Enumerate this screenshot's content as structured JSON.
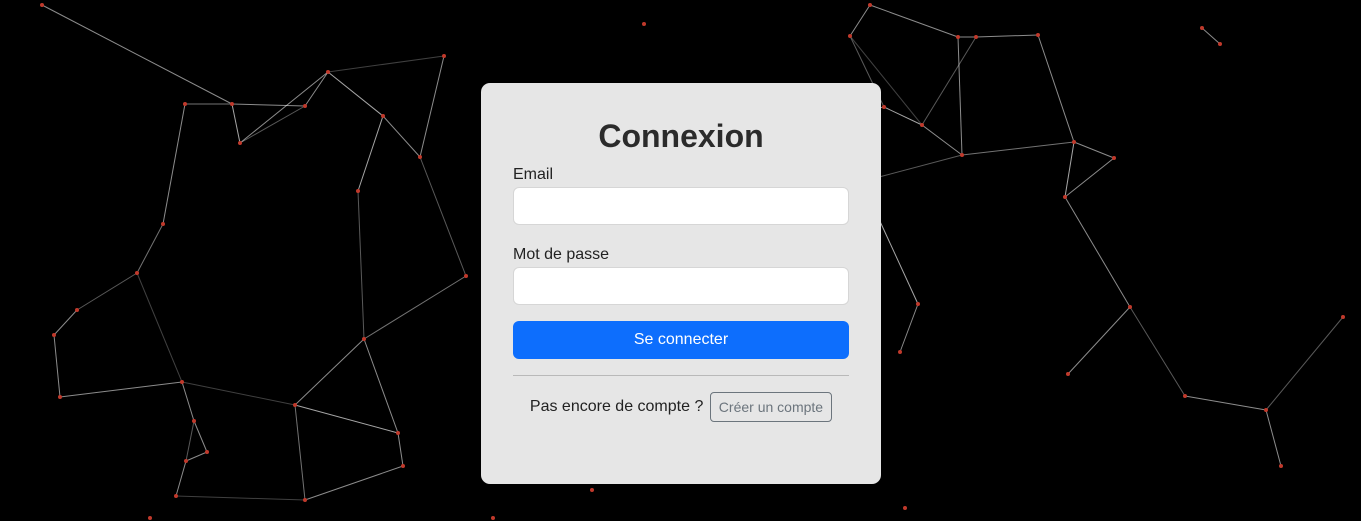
{
  "login": {
    "title": "Connexion",
    "email_label": "Email",
    "email_value": "",
    "password_label": "Mot de passe",
    "password_value": "",
    "submit_label": "Se connecter",
    "no_account_text": "Pas encore de compte ?",
    "register_label": "Créer un compte"
  },
  "colors": {
    "background": "#000000",
    "card": "#e6e6e6",
    "primary": "#0d6efd",
    "secondary": "#6c757d",
    "node": "#c0392b",
    "line": "#ffffff"
  }
}
